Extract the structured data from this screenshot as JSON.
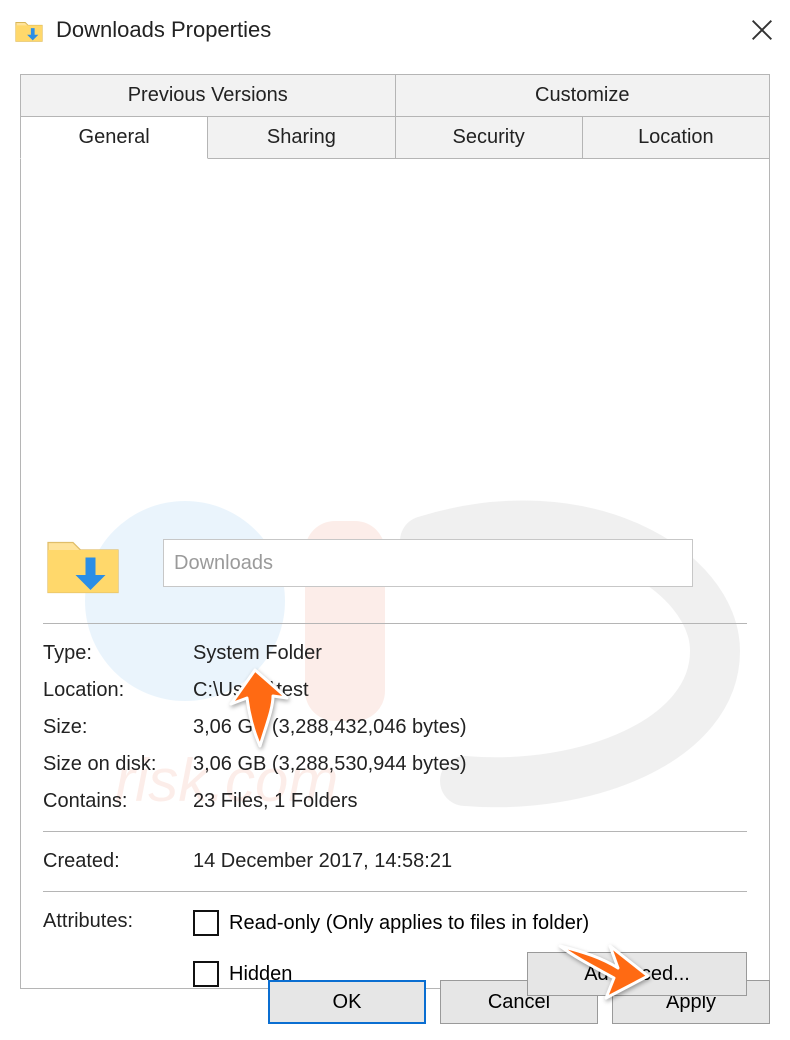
{
  "title": "Downloads Properties",
  "tabs_top": [
    "Previous Versions",
    "Customize"
  ],
  "tabs_bottom": [
    "General",
    "Sharing",
    "Security",
    "Location"
  ],
  "active_tab": "General",
  "folder_name": "Downloads",
  "fields": {
    "type_label": "Type:",
    "type_value": "System Folder",
    "location_label": "Location:",
    "location_value": "C:\\Users\\test",
    "size_label": "Size:",
    "size_value": "3,06 GB (3,288,432,046 bytes)",
    "size_on_disk_label": "Size on disk:",
    "size_on_disk_value": "3,06 GB (3,288,530,944 bytes)",
    "contains_label": "Contains:",
    "contains_value": "23 Files, 1 Folders",
    "created_label": "Created:",
    "created_value": "14 December 2017, 14:58:21",
    "attributes_label": "Attributes:"
  },
  "attributes": {
    "readonly_label": "Read-only (Only applies to files in folder)",
    "hidden_label": "Hidden",
    "advanced_button": "Advanced..."
  },
  "buttons": {
    "ok": "OK",
    "cancel": "Cancel",
    "apply": "Apply"
  }
}
